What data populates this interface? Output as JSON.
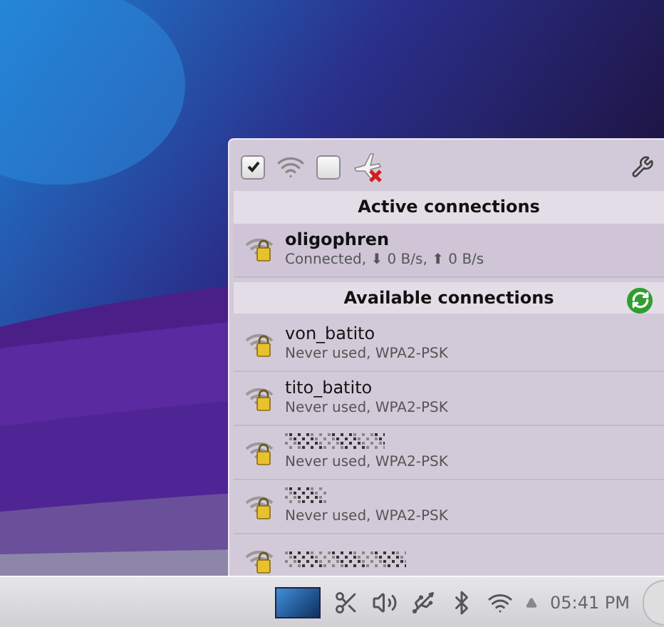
{
  "toolbar": {
    "wireless_enabled": {
      "checked": true
    },
    "airplane_mode": {
      "checked": false
    }
  },
  "active_section": {
    "title": "Active connections",
    "connections": [
      {
        "name": "oligophren",
        "status": "Connected, ⬇ 0 B/s, ⬆ 0 B/s"
      }
    ]
  },
  "available_section": {
    "title": "Available connections",
    "networks": [
      {
        "name": "von_batito",
        "obscured": false,
        "details": "Never used, WPA2-PSK"
      },
      {
        "name": "tito_batito",
        "obscured": false,
        "details": "Never used, WPA2-PSK"
      },
      {
        "obscured": true,
        "details": "Never used, WPA2-PSK"
      },
      {
        "obscured": true,
        "details": "Never used, WPA2-PSK"
      },
      {
        "obscured": true
      }
    ]
  },
  "taskbar": {
    "clock": "05:41 PM"
  }
}
